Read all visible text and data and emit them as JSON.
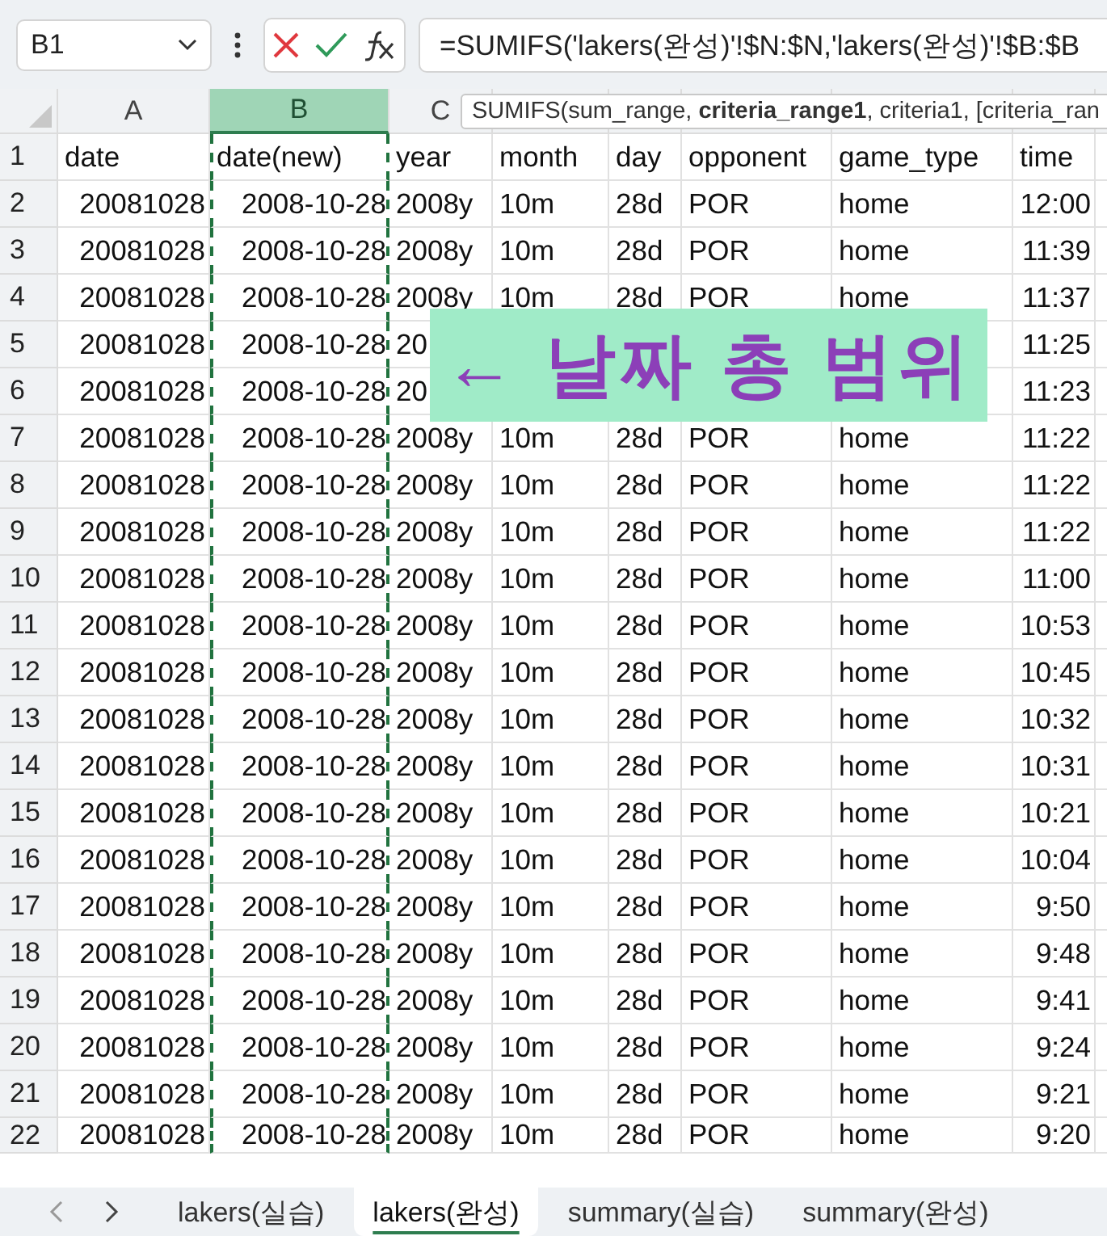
{
  "formula_bar": {
    "name_box": "B1",
    "formula": "=SUMIFS('lakers(완성)'!$N:$N,'lakers(완성)'!$B:$B"
  },
  "tooltip": "SUMIFS(sum_range, **criteria_range1**, criteria1, [criteria_ran",
  "columns": [
    {
      "letter": "A",
      "selected": false,
      "copied": false
    },
    {
      "letter": "B",
      "selected": true,
      "copied": true
    },
    {
      "letter": "C",
      "selected": false,
      "copied": false
    }
  ],
  "rows": [
    {
      "number": "1",
      "cells": [
        "date",
        "date(new)",
        "year",
        "month",
        "day",
        "opponent",
        "game_type",
        "time"
      ]
    },
    {
      "number": "2",
      "cells": [
        "20081028",
        "2008-10-28",
        "2008y",
        "10m",
        "28d",
        "POR",
        "home",
        "12:00"
      ]
    },
    {
      "number": "3",
      "cells": [
        "20081028",
        "2008-10-28",
        "2008y",
        "10m",
        "28d",
        "POR",
        "home",
        "11:39"
      ]
    },
    {
      "number": "4",
      "cells": [
        "20081028",
        "2008-10-28",
        "2008y",
        "10m",
        "28d",
        "POR",
        "home",
        "11:37"
      ]
    },
    {
      "number": "5",
      "cells": [
        "20081028",
        "2008-10-28",
        "20",
        null,
        null,
        null,
        null,
        "11:25"
      ]
    },
    {
      "number": "6",
      "cells": [
        "20081028",
        "2008-10-28",
        "20",
        null,
        null,
        null,
        null,
        "11:23"
      ]
    },
    {
      "number": "7",
      "cells": [
        "20081028",
        "2008-10-28",
        "2008y",
        "10m",
        "28d",
        "POR",
        "home",
        "11:22"
      ]
    },
    {
      "number": "8",
      "cells": [
        "20081028",
        "2008-10-28",
        "2008y",
        "10m",
        "28d",
        "POR",
        "home",
        "11:22"
      ]
    },
    {
      "number": "9",
      "cells": [
        "20081028",
        "2008-10-28",
        "2008y",
        "10m",
        "28d",
        "POR",
        "home",
        "11:22"
      ]
    },
    {
      "number": "10",
      "cells": [
        "20081028",
        "2008-10-28",
        "2008y",
        "10m",
        "28d",
        "POR",
        "home",
        "11:00"
      ]
    },
    {
      "number": "11",
      "cells": [
        "20081028",
        "2008-10-28",
        "2008y",
        "10m",
        "28d",
        "POR",
        "home",
        "10:53"
      ]
    },
    {
      "number": "12",
      "cells": [
        "20081028",
        "2008-10-28",
        "2008y",
        "10m",
        "28d",
        "POR",
        "home",
        "10:45"
      ]
    },
    {
      "number": "13",
      "cells": [
        "20081028",
        "2008-10-28",
        "2008y",
        "10m",
        "28d",
        "POR",
        "home",
        "10:32"
      ]
    },
    {
      "number": "14",
      "cells": [
        "20081028",
        "2008-10-28",
        "2008y",
        "10m",
        "28d",
        "POR",
        "home",
        "10:31"
      ]
    },
    {
      "number": "15",
      "cells": [
        "20081028",
        "2008-10-28",
        "2008y",
        "10m",
        "28d",
        "POR",
        "home",
        "10:21"
      ]
    },
    {
      "number": "16",
      "cells": [
        "20081028",
        "2008-10-28",
        "2008y",
        "10m",
        "28d",
        "POR",
        "home",
        "10:04"
      ]
    },
    {
      "number": "17",
      "cells": [
        "20081028",
        "2008-10-28",
        "2008y",
        "10m",
        "28d",
        "POR",
        "home",
        "9:50"
      ]
    },
    {
      "number": "18",
      "cells": [
        "20081028",
        "2008-10-28",
        "2008y",
        "10m",
        "28d",
        "POR",
        "home",
        "9:48"
      ]
    },
    {
      "number": "19",
      "cells": [
        "20081028",
        "2008-10-28",
        "2008y",
        "10m",
        "28d",
        "POR",
        "home",
        "9:41"
      ]
    },
    {
      "number": "20",
      "cells": [
        "20081028",
        "2008-10-28",
        "2008y",
        "10m",
        "28d",
        "POR",
        "home",
        "9:24"
      ]
    },
    {
      "number": "21",
      "cells": [
        "20081028",
        "2008-10-28",
        "2008y",
        "10m",
        "28d",
        "POR",
        "home",
        "9:21"
      ]
    },
    {
      "number": "22",
      "cells": [
        "20081028",
        "2008-10-28",
        "2008y",
        "10m",
        "28d",
        "POR",
        "home",
        "9:20"
      ]
    }
  ],
  "annotation": "← 날짜 총 범위",
  "sheet_tabs": [
    {
      "label": "lakers(실습)",
      "selected": false
    },
    {
      "label": "lakers(완성)",
      "selected": true
    },
    {
      "label": "summary(실습)",
      "selected": false
    },
    {
      "label": "summary(완성)",
      "selected": false
    }
  ]
}
